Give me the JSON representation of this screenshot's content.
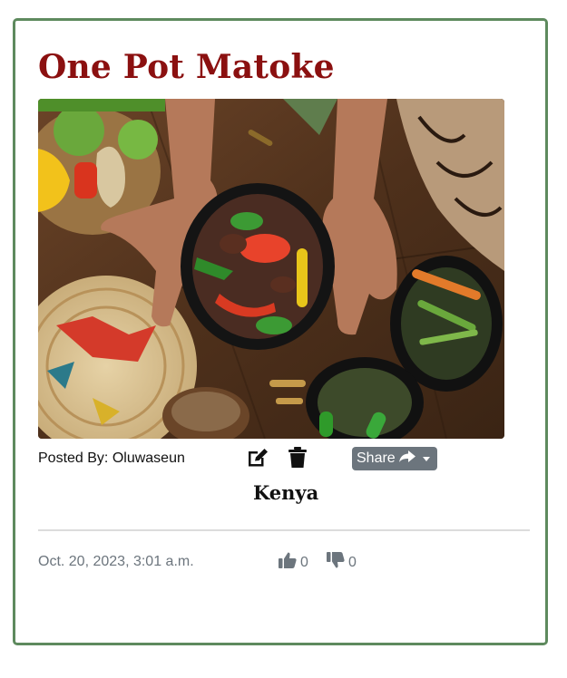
{
  "post": {
    "title": "One Pot Matoke",
    "posted_by_label": "Posted By: Oluwaseun",
    "share_label": "Share",
    "country": "Kenya",
    "date": "Oct. 20, 2023, 3:01 a.m.",
    "likes": "0",
    "dislikes": "0"
  },
  "icons": {
    "edit": "edit-icon",
    "delete": "trash-icon",
    "share": "share-arrow-icon",
    "like": "thumbs-up-icon",
    "dislike": "thumbs-down-icon"
  },
  "colors": {
    "title": "#8b1010",
    "card_border": "#5e8a5e",
    "share_button": "#6c757d",
    "muted_text": "#6c757d"
  }
}
